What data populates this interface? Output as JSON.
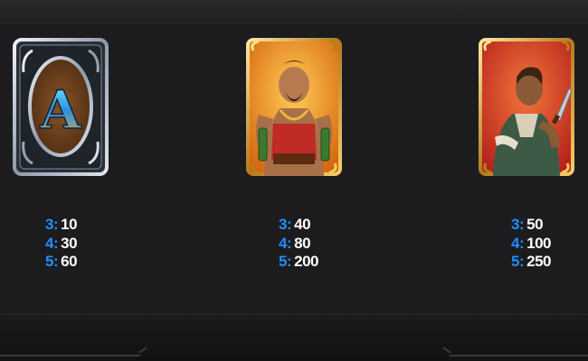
{
  "colors": {
    "background": "#1c1c1e",
    "count_color": "#1f8fff",
    "value_color": "#ffffff",
    "silver_frame": "#b8c4d4",
    "gold_frame": "#d9a437"
  },
  "symbols": [
    {
      "icon": "letter-a-card-icon",
      "letter": "A",
      "payouts": [
        {
          "count": "3:",
          "value": "10"
        },
        {
          "count": "4:",
          "value": "30"
        },
        {
          "count": "5:",
          "value": "60"
        }
      ]
    },
    {
      "icon": "strongman-card-icon",
      "payouts": [
        {
          "count": "3:",
          "value": "40"
        },
        {
          "count": "4:",
          "value": "80"
        },
        {
          "count": "5:",
          "value": "200"
        }
      ]
    },
    {
      "icon": "hunter-card-icon",
      "payouts": [
        {
          "count": "3:",
          "value": "50"
        },
        {
          "count": "4:",
          "value": "100"
        },
        {
          "count": "5:",
          "value": "250"
        }
      ]
    }
  ]
}
